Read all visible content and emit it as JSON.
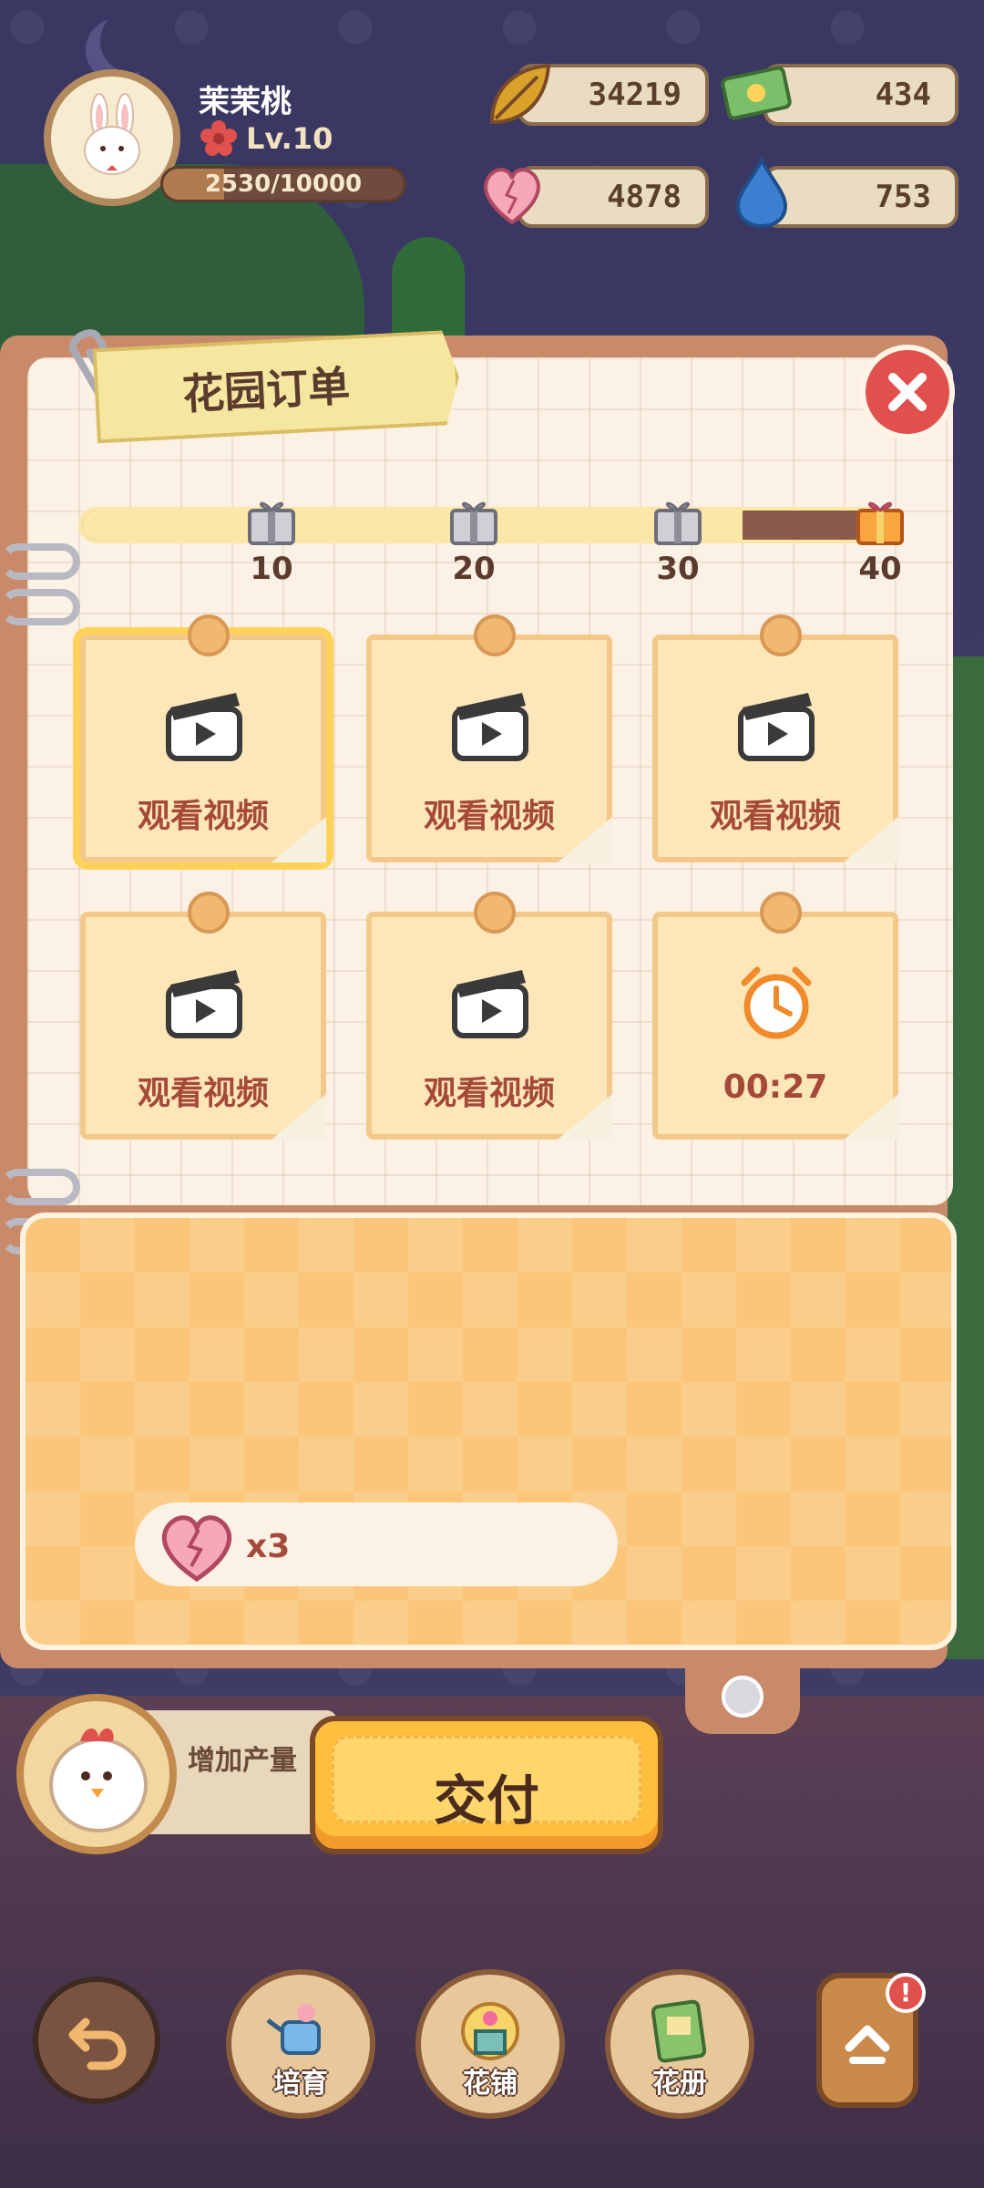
{
  "player": {
    "name": "茉茉桃",
    "level": "Lv.10",
    "xp_text": "2530/10000",
    "xp_fraction": 0.253
  },
  "resources": {
    "leaf": "34219",
    "ticket": "434",
    "heart": "4878",
    "water": "753"
  },
  "panel": {
    "title": "花园订单"
  },
  "progress": {
    "fraction": 0.82,
    "milestones": [
      "10",
      "20",
      "30",
      "40"
    ]
  },
  "orders": [
    {
      "type": "video",
      "label": "观看视频"
    },
    {
      "type": "video",
      "label": "观看视频"
    },
    {
      "type": "video",
      "label": "观看视频"
    },
    {
      "type": "video",
      "label": "观看视频"
    },
    {
      "type": "video",
      "label": "观看视频"
    },
    {
      "type": "timer",
      "label": "00:27"
    }
  ],
  "reward": {
    "multiplier": "x3"
  },
  "production": {
    "label": "增加产量"
  },
  "submit": {
    "label": "交付"
  },
  "nav": {
    "items": [
      "培育",
      "花铺",
      "花册"
    ],
    "badge": "!"
  },
  "colors": {
    "accent": "#ffbf3e",
    "close": "#e0504d",
    "card_text": "#a54a3a",
    "progress_fill": "#fbe7a8"
  }
}
